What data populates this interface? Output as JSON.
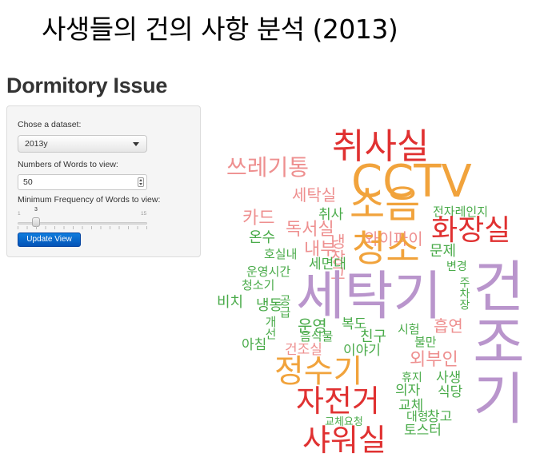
{
  "slide": {
    "title": "사생들의 건의 사항 분석 (2013)"
  },
  "app": {
    "title": "Dormitory Issue",
    "dataset_label": "Chose a dataset:",
    "dataset_value": "2013y",
    "words_label": "Numbers of Words to view:",
    "words_value": "50",
    "freq_label": "Minimum Frequency of Words to view:",
    "freq_value": "3",
    "freq_min": "1",
    "freq_max": "15",
    "update_button": "Update View"
  },
  "wordcloud": {
    "colors": {
      "orange": "#f1a33c",
      "red": "#e03131",
      "green": "#4aab4a",
      "purple": "#b995cc",
      "pink": "#ee8f8f"
    },
    "words": [
      {
        "text": "취사실",
        "color": "#e03131"
      },
      {
        "text": "쓰레기통",
        "color": "#ee8f8f"
      },
      {
        "text": "CCTV",
        "color": "#f1a33c"
      },
      {
        "text": "세탁실",
        "color": "#ee8f8f"
      },
      {
        "text": "소음",
        "color": "#f1a33c"
      },
      {
        "text": "카드",
        "color": "#ee8f8f"
      },
      {
        "text": "독서실",
        "color": "#ee8f8f"
      },
      {
        "text": "취사",
        "color": "#4aab4a"
      },
      {
        "text": "냉장고",
        "color": "#ee8f8f"
      },
      {
        "text": "와이파이",
        "color": "#ee8f8f"
      },
      {
        "text": "전자레인지",
        "color": "#4aab4a"
      },
      {
        "text": "화장실",
        "color": "#e03131"
      },
      {
        "text": "온수",
        "color": "#4aab4a"
      },
      {
        "text": "내부",
        "color": "#ee8f8f"
      },
      {
        "text": "청소",
        "color": "#f1a33c"
      },
      {
        "text": "문제",
        "color": "#4aab4a"
      },
      {
        "text": "호실내",
        "color": "#4aab4a"
      },
      {
        "text": "세면대",
        "color": "#4aab4a"
      },
      {
        "text": "변경",
        "color": "#4aab4a"
      },
      {
        "text": "운영시간",
        "color": "#4aab4a"
      },
      {
        "text": "세탁기",
        "color": "#b995cc"
      },
      {
        "text": "건조기",
        "color": "#b995cc"
      },
      {
        "text": "청소기",
        "color": "#4aab4a"
      },
      {
        "text": "주차장",
        "color": "#4aab4a"
      },
      {
        "text": "비치",
        "color": "#4aab4a"
      },
      {
        "text": "냉동",
        "color": "#4aab4a"
      },
      {
        "text": "공급",
        "color": "#4aab4a"
      },
      {
        "text": "개선",
        "color": "#4aab4a"
      },
      {
        "text": "운영",
        "color": "#4aab4a"
      },
      {
        "text": "복도",
        "color": "#4aab4a"
      },
      {
        "text": "흡연",
        "color": "#ee8f8f"
      },
      {
        "text": "음식물",
        "color": "#4aab4a"
      },
      {
        "text": "친구",
        "color": "#4aab4a"
      },
      {
        "text": "시험",
        "color": "#4aab4a"
      },
      {
        "text": "불만",
        "color": "#4aab4a"
      },
      {
        "text": "아침",
        "color": "#4aab4a"
      },
      {
        "text": "건조실",
        "color": "#ee8f8f"
      },
      {
        "text": "이야기",
        "color": "#4aab4a"
      },
      {
        "text": "외부인",
        "color": "#ee8f8f"
      },
      {
        "text": "정수기",
        "color": "#f1a33c"
      },
      {
        "text": "휴지",
        "color": "#4aab4a"
      },
      {
        "text": "의자",
        "color": "#4aab4a"
      },
      {
        "text": "사생",
        "color": "#4aab4a"
      },
      {
        "text": "식당",
        "color": "#4aab4a"
      },
      {
        "text": "자전거",
        "color": "#e03131"
      },
      {
        "text": "교체",
        "color": "#4aab4a"
      },
      {
        "text": "대형",
        "color": "#4aab4a"
      },
      {
        "text": "창고",
        "color": "#4aab4a"
      },
      {
        "text": "교체요청",
        "color": "#4aab4a"
      },
      {
        "text": "샤워실",
        "color": "#e03131"
      },
      {
        "text": "토스터",
        "color": "#4aab4a"
      }
    ]
  }
}
